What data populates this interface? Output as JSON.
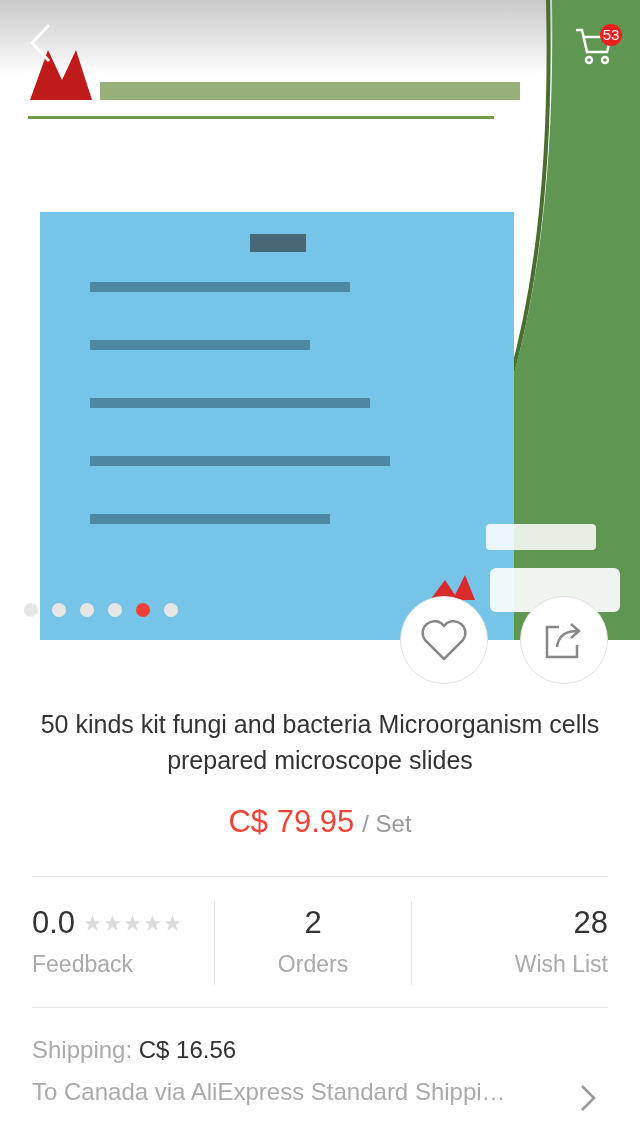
{
  "header": {
    "cart_badge": "53"
  },
  "gallery": {
    "kind": "picture",
    "dots": [
      {
        "selected": false
      },
      {
        "selected": false
      },
      {
        "selected": false
      },
      {
        "selected": false
      },
      {
        "selected": true
      },
      {
        "selected": false
      }
    ]
  },
  "product": {
    "title": "50 kinds kit fungi and bacteria Microorganism cells prepared microscope slides",
    "price": "C$ 79.95",
    "unit": "/ Set"
  },
  "stats": [
    {
      "kind": "rating",
      "value": "0.0",
      "stars": 0,
      "label": "Feedback"
    },
    {
      "kind": "count",
      "value": "2",
      "label": "Orders"
    },
    {
      "kind": "count",
      "value": "28",
      "label": "Wish List"
    }
  ],
  "shipping": {
    "label": "Shipping:",
    "cost": "C$ 16.56",
    "route": "To Canada via AliExpress Standard Shippi…"
  }
}
